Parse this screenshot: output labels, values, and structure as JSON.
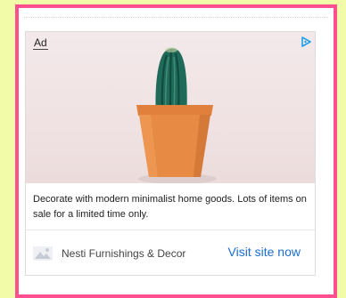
{
  "ad": {
    "label": "Ad",
    "description": "Decorate with modern minimalist home goods. Lots of items on sale for a limited time only.",
    "advertiser": "Nesti Furnishings & Decor",
    "cta": "Visit site now",
    "adchoices_icon": "play-triangle-icon",
    "image": "cactus in orange pot on pink background"
  },
  "colors": {
    "page_background": "#f2fca8",
    "frame_border": "#ff4f91",
    "cta": "#1a6fd1",
    "pot": "#e68a44",
    "cactus": "#1f6a59"
  }
}
